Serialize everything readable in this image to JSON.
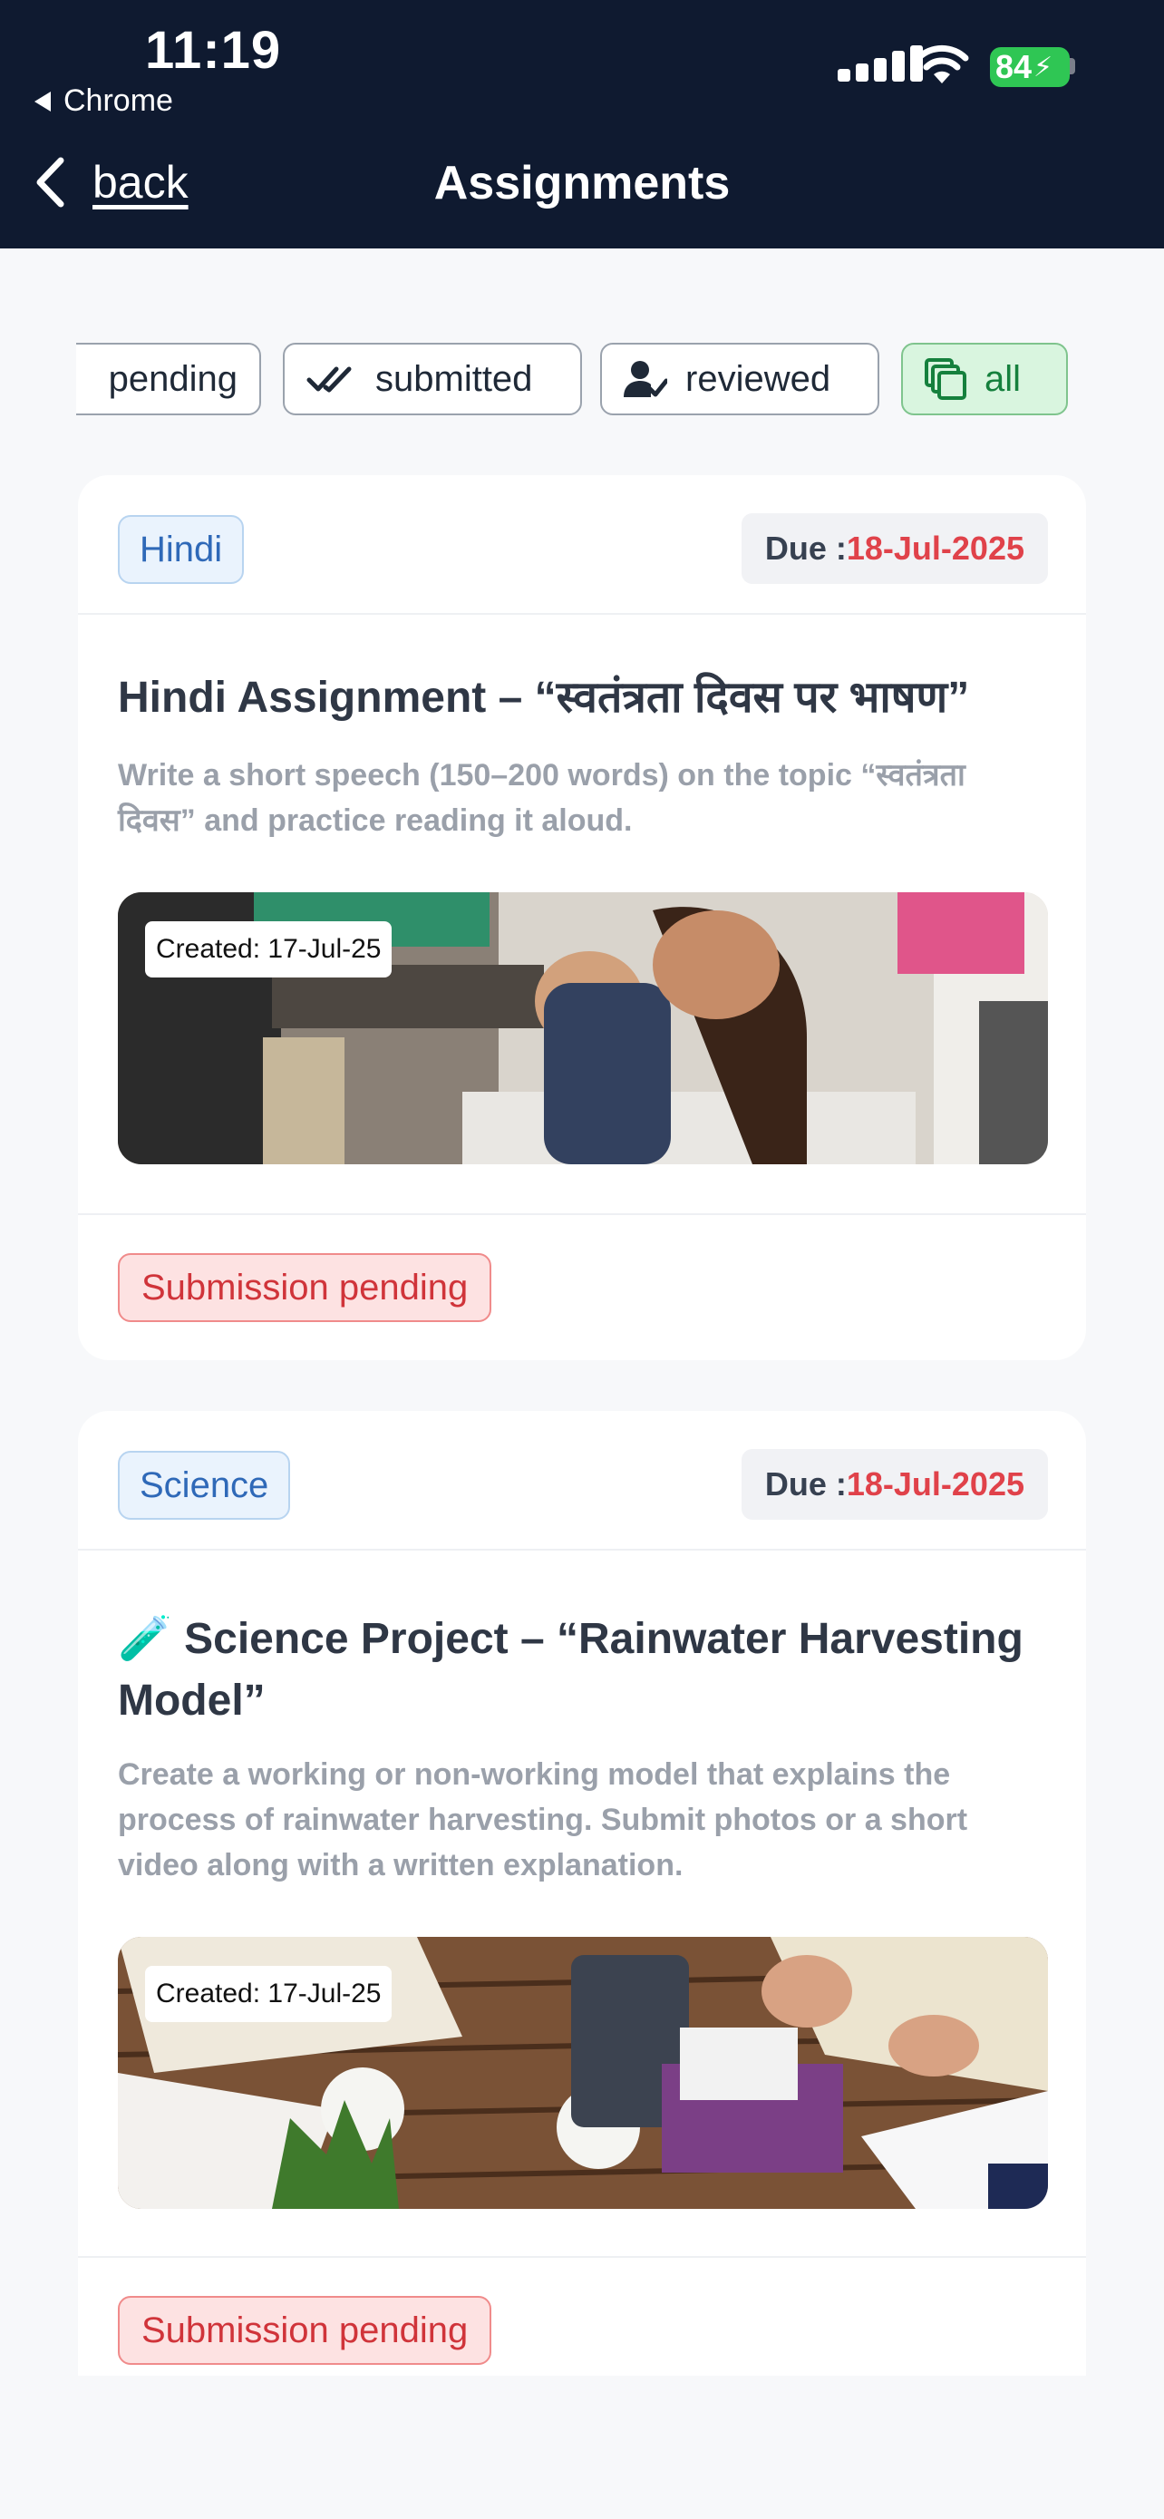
{
  "status_bar": {
    "time": "11:19",
    "back_app": "Chrome",
    "battery": "84"
  },
  "nav": {
    "back_label": "back",
    "title": "Assignments"
  },
  "filters": [
    {
      "label": "pending",
      "icon": "clock-icon",
      "active": false
    },
    {
      "label": "submitted",
      "icon": "double-check-icon",
      "active": false
    },
    {
      "label": "reviewed",
      "icon": "user-check-icon",
      "active": false
    },
    {
      "label": "all",
      "icon": "stack-icon",
      "active": true
    }
  ],
  "assignments": [
    {
      "subject": "Hindi",
      "due_prefix": "Due :",
      "due_date": "18-Jul-2025",
      "title": "Hindi Assignment – “स्वतंत्रता दिवस पर भाषण”",
      "description": "Write a short speech (150–200 words) on the topic “स्वतंत्रता दिवस” and practice reading it aloud.",
      "created": "Created: 17-Jul-25",
      "status": "Submission pending"
    },
    {
      "subject": "Science",
      "due_prefix": "Due :",
      "due_date": "18-Jul-2025",
      "title_emoji": "🧪",
      "title": "Science Project – “Rainwater Harvesting Model”",
      "description": "Create a working or non-working model that explains the process of rainwater harvesting. Submit photos or a short video along with a written explanation.",
      "created": "Created: 17-Jul-25",
      "status": "Submission pending"
    }
  ],
  "colors": {
    "header_bg": "#0f1a30",
    "due_date": "#e0424a",
    "active_chip": "#d9f5df",
    "pending_badge": "#fde2e2"
  }
}
